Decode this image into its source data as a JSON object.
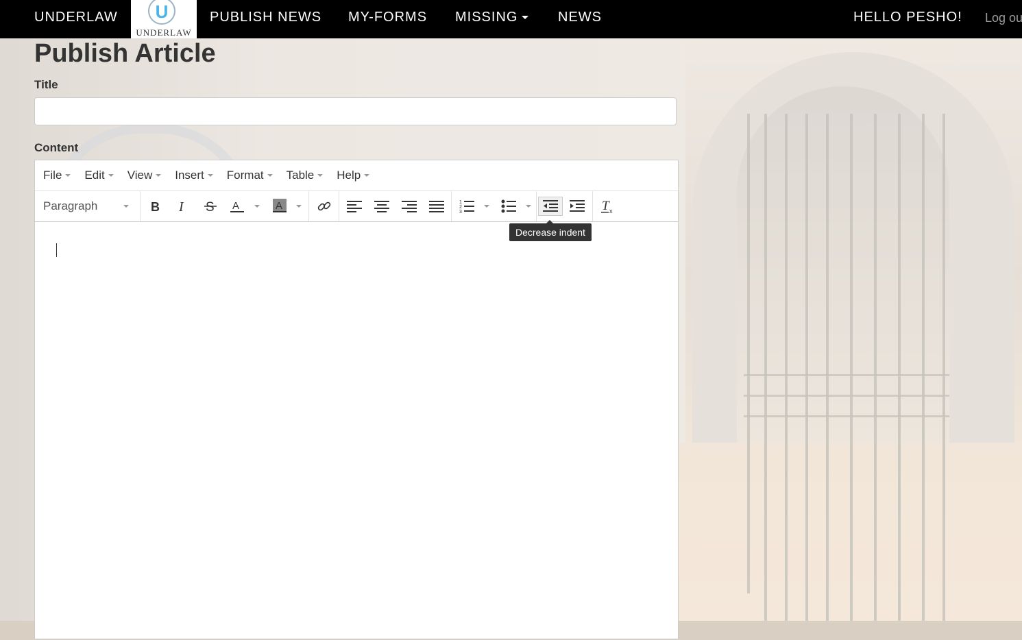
{
  "nav": {
    "brand": "UNDERLAW",
    "logo_letter": "U",
    "logo_text": "UNDERLAW",
    "links": [
      "PUBLISH NEWS",
      "MY-FORMS",
      "MISSING",
      "NEWS"
    ],
    "greeting": "HELLO PESHO!",
    "logout": "Log out"
  },
  "page": {
    "heading": "Publish Article",
    "title_label": "Title",
    "title_value": "",
    "content_label": "Content"
  },
  "editor": {
    "menu": [
      "File",
      "Edit",
      "View",
      "Insert",
      "Format",
      "Table",
      "Help"
    ],
    "block_format": "Paragraph",
    "tooltip": "Decrease indent",
    "icons": [
      "bold-icon",
      "italic-icon",
      "strikethrough-icon",
      "text-color-icon",
      "background-color-icon",
      "link-icon",
      "align-left-icon",
      "align-center-icon",
      "align-right-icon",
      "align-justify-icon",
      "numbered-list-icon",
      "bullet-list-icon",
      "decrease-indent-icon",
      "increase-indent-icon",
      "clear-formatting-icon"
    ]
  },
  "colors": {
    "navbar_bg": "#000000",
    "logo_accent": "#4ab4e6",
    "tooltip_bg": "#333333"
  }
}
